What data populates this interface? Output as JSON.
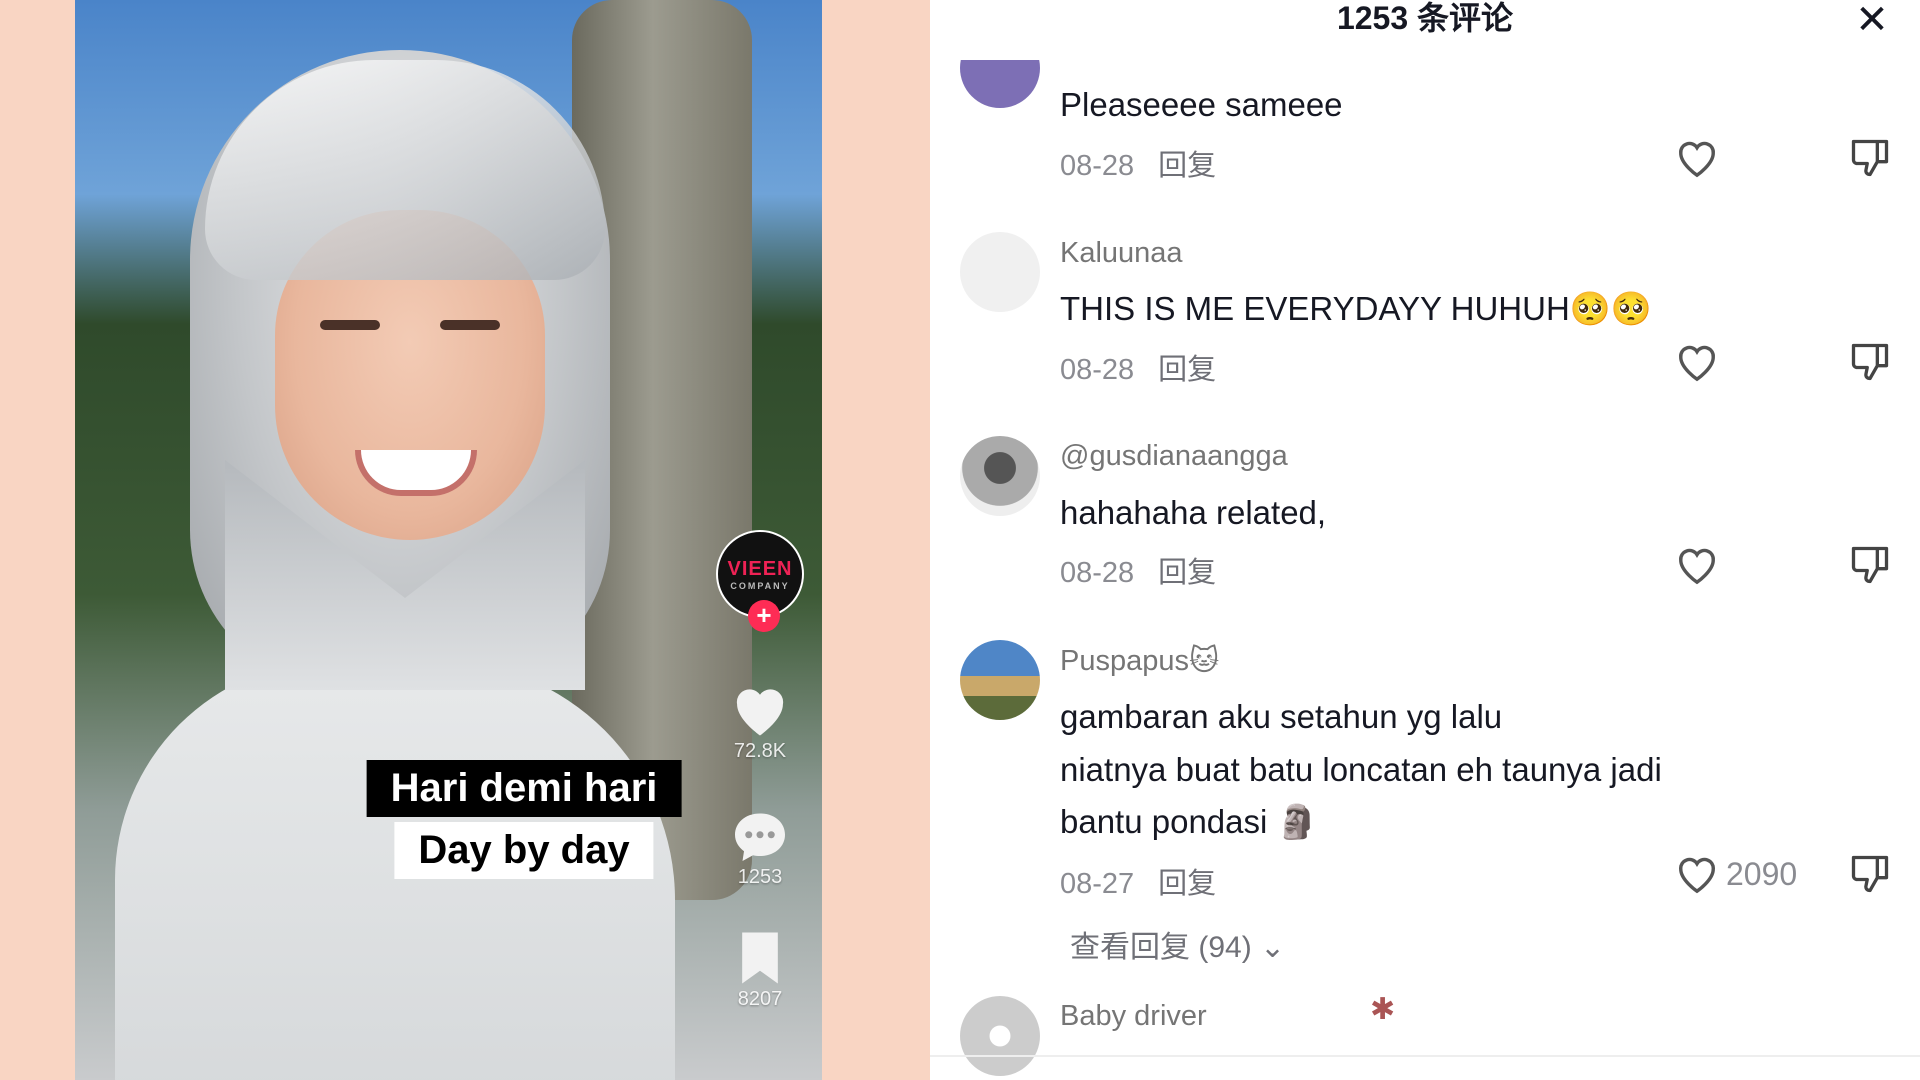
{
  "video": {
    "subtitle_line1": "Hari demi hari",
    "subtitle_line2": "Day by day",
    "creator_logo": "VIEEN",
    "creator_logo_sub": "COMPANY",
    "follow_symbol": "+",
    "likes": "72.8K",
    "comments": "1253",
    "saves": "8207"
  },
  "panel": {
    "title": "1253 条评论",
    "close_symbol": "✕"
  },
  "comments": [
    {
      "user": "",
      "lines": [
        "Pleaseeee sameee"
      ],
      "date": "08-28",
      "reply": "回复",
      "likes": ""
    },
    {
      "user": "Kaluunaa",
      "lines": [
        "THIS IS ME EVERYDAYY HUHUH🥺🥺"
      ],
      "date": "08-28",
      "reply": "回复",
      "likes": ""
    },
    {
      "user": "@gusdianaangga",
      "lines": [
        "hahahaha related,"
      ],
      "date": "08-28",
      "reply": "回复",
      "likes": ""
    },
    {
      "user": "Puspapus🐱",
      "lines": [
        "gambaran aku setahun yg lalu",
        "niatnya buat batu loncatan eh taunya jadi",
        "bantu pondasi 🗿"
      ],
      "date": "08-27",
      "reply": "回复",
      "likes": "2090",
      "view_replies": "查看回复 (94) ⌄"
    },
    {
      "user": "Baby driver",
      "lines": [],
      "date": "",
      "reply": "",
      "likes": ""
    }
  ],
  "colors": {
    "accent_follow": "#fe2c55",
    "page_background": "#f9d5c3",
    "panel_background": "#ffffff"
  },
  "icons": [
    "heart-icon",
    "dislike-icon",
    "comment-icon",
    "bookmark-icon",
    "close-icon",
    "plus-icon",
    "chevron-down-icon",
    "cockroach-icon"
  ]
}
